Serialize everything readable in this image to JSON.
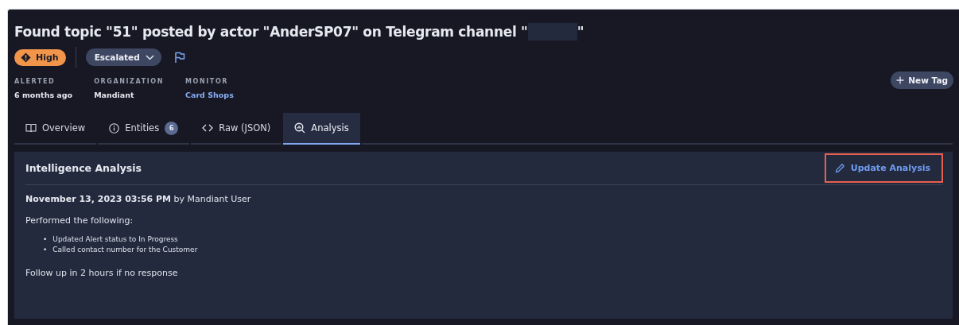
{
  "title": {
    "text": "Found topic \"51\" posted by actor \"AnderSP07\" on Telegram channel \"",
    "redacted": true,
    "end": "\""
  },
  "severity": {
    "label": "High"
  },
  "status": {
    "label": "Escalated"
  },
  "flagged": false,
  "new_tag": "New Tag",
  "meta": [
    {
      "label": "ALERTED",
      "value": "6 months ago",
      "kind": "text"
    },
    {
      "label": "ORGANIZATION",
      "value": "Mandiant",
      "kind": "text"
    },
    {
      "label": "MONITOR",
      "value": "Card Shops",
      "kind": "link"
    }
  ],
  "tabs": [
    {
      "label": "Overview",
      "selected": false
    },
    {
      "label": "Entities",
      "count": "6",
      "selected": false
    },
    {
      "label": "Raw (JSON)",
      "selected": false
    },
    {
      "label": "Analysis",
      "selected": true
    }
  ],
  "panel": {
    "title": "Intelligence Analysis",
    "action": {
      "label": "Update Analysis",
      "highlighted": true
    },
    "timestamp": "November 13, 2023 03:56 PM",
    "author": "by Mandiant User",
    "intro": "Performed the following:",
    "bullets": [
      {
        "marker": "•",
        "text": "Updated Alert status to In Progress"
      },
      {
        "marker": "•",
        "text": "Called contact number for the Customer"
      }
    ],
    "footer": "Follow up in 2 hours if no response"
  }
}
